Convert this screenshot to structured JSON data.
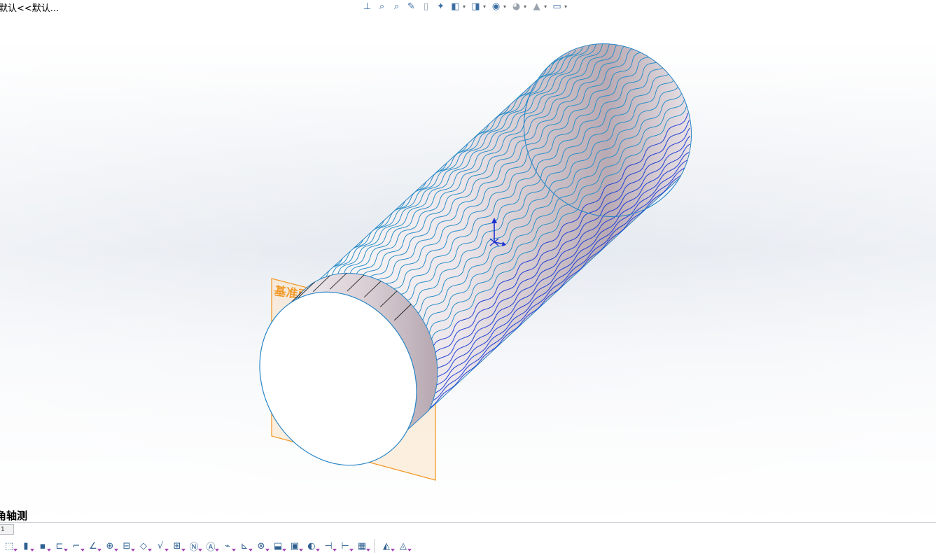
{
  "viewport": {
    "config_label": "默认<<默认...",
    "view_orientation": "角轴测",
    "plane_label": "基准面1"
  },
  "heads_up_toolbar": [
    {
      "name": "view-orientation-icon",
      "glyph": "⊥"
    },
    {
      "name": "zoom-to-fit-icon",
      "glyph": "⌕"
    },
    {
      "name": "zoom-to-area-icon",
      "glyph": "⌕"
    },
    {
      "name": "previous-view-icon",
      "glyph": "✎"
    },
    {
      "name": "section-view-icon",
      "glyph": "▯",
      "gray": true
    },
    {
      "name": "dynamic-annotation-icon",
      "glyph": "✦"
    },
    {
      "name": "view-orientation-dropdown-icon",
      "glyph": "◧",
      "caret": true
    },
    {
      "name": "display-style-icon",
      "glyph": "◨",
      "caret": true
    },
    {
      "name": "hide-show-items-icon",
      "glyph": "◉",
      "caret": true
    },
    {
      "name": "edit-appearance-icon",
      "glyph": "◕",
      "caret": true,
      "gray": true
    },
    {
      "name": "apply-scene-icon",
      "glyph": "▲",
      "caret": true,
      "gray": true
    },
    {
      "name": "view-settings-icon",
      "glyph": "▭",
      "caret": true
    }
  ],
  "bottom_tab": {
    "label": "1"
  },
  "annotation_toolbar": [
    {
      "name": "smart-dimension-icon",
      "glyph": "⬚"
    },
    {
      "name": "model-items-icon",
      "glyph": "▮"
    },
    {
      "name": "note-icon",
      "glyph": "▪"
    },
    {
      "name": "linear-pattern-icon",
      "glyph": "⊏"
    },
    {
      "name": "datum-icon",
      "glyph": "⌐"
    },
    {
      "name": "spell-checker-icon",
      "glyph": "∠"
    },
    {
      "name": "format-painter-icon",
      "glyph": "⊕"
    },
    {
      "name": "balloon-icon",
      "glyph": "⊟"
    },
    {
      "name": "auto-balloon-icon",
      "glyph": "◇"
    },
    {
      "name": "surface-finish-icon",
      "glyph": "√"
    },
    {
      "name": "weld-symbol-icon",
      "glyph": "⊞"
    },
    {
      "name": "hole-callout-icon",
      "glyph": "Ⓝ"
    },
    {
      "name": "geometric-tolerance-icon",
      "glyph": "Ⓐ"
    },
    {
      "name": "datum-feature-icon",
      "glyph": "⌁"
    },
    {
      "name": "datum-target-icon",
      "glyph": "⊾"
    },
    {
      "name": "center-mark-icon",
      "glyph": "⊗"
    },
    {
      "name": "centerline-icon",
      "glyph": "⬓"
    },
    {
      "name": "area-hatch-icon",
      "glyph": "▣"
    },
    {
      "name": "block-icon",
      "glyph": "◐"
    },
    {
      "name": "revision-symbol-icon",
      "glyph": "⊣"
    },
    {
      "name": "magnetic-line-icon",
      "glyph": "⊢"
    },
    {
      "name": "table-icon",
      "glyph": "▦"
    },
    {
      "name": "annotation-view-icon",
      "glyph": "◭",
      "sep_before": true
    },
    {
      "name": "annotation-settings-icon",
      "glyph": "◬"
    }
  ]
}
